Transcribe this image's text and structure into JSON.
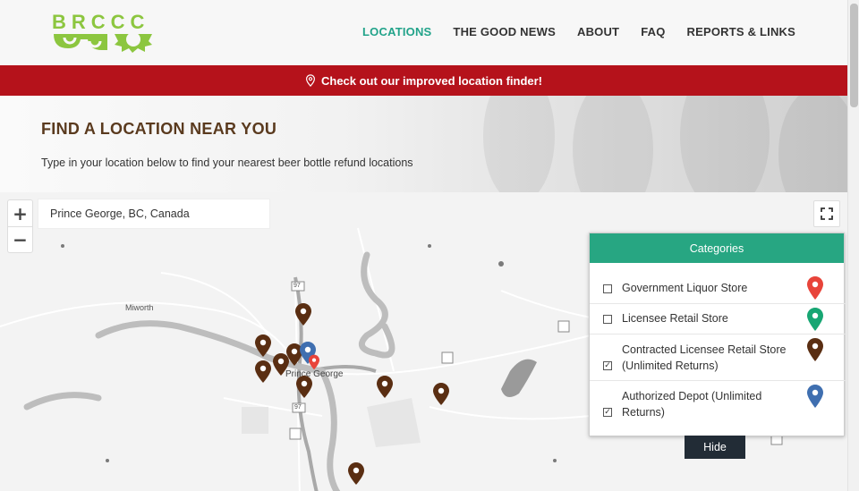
{
  "header": {
    "logo_text": "BRCCC",
    "nav": [
      {
        "label": "LOCATIONS",
        "active": true
      },
      {
        "label": "THE GOOD NEWS",
        "active": false
      },
      {
        "label": "ABOUT",
        "active": false
      },
      {
        "label": "FAQ",
        "active": false
      },
      {
        "label": "REPORTS & LINKS",
        "active": false
      }
    ]
  },
  "banner": {
    "text": "Check out our improved location finder!",
    "icon": "map-pin-icon"
  },
  "hero": {
    "title": "FIND A LOCATION NEAR YOU",
    "subtitle": "Type in your location below to find your nearest beer bottle refund locations"
  },
  "map": {
    "search_value": "Prince George, BC, Canada",
    "zoom_in": "+",
    "zoom_out": "−",
    "labels": {
      "city": "Prince George",
      "town": "Miworth",
      "hwy1": "97",
      "hwy2": "97"
    }
  },
  "categories": {
    "title": "Categories",
    "items": [
      {
        "label": "Government Liquor Store",
        "checked": false,
        "color": "#e8443a"
      },
      {
        "label": "Licensee Retail Store",
        "checked": false,
        "color": "#17a673"
      },
      {
        "label": "Contracted Licensee Retail Store (Unlimited Returns)",
        "checked": true,
        "color": "#5a2e12"
      },
      {
        "label": "Authorized Depot (Unlimited Returns)",
        "checked": true,
        "color": "#3f6fb0"
      }
    ],
    "hide_label": "Hide"
  },
  "colors": {
    "accent": "#22a38a",
    "banner": "#b5121b",
    "brand_green": "#8cc63f",
    "heading": "#5a3a1e"
  }
}
